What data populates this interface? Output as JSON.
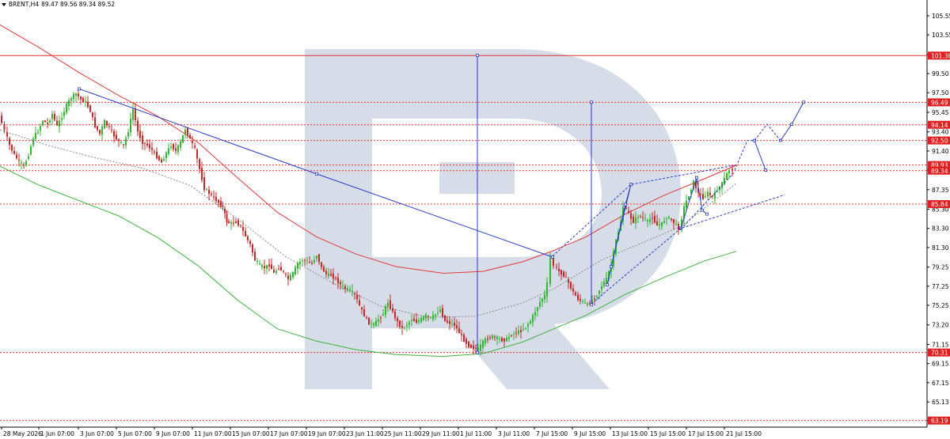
{
  "header": {
    "symbol": "BRENT,H4",
    "ohlc": "89.47 89.56 89.34 89.52"
  },
  "colors": {
    "bull": "#2eb82e",
    "bear": "#c62828",
    "level": "#e03030",
    "projection": "#2a3cc8",
    "ma_red": "#e03a3a",
    "ma_green": "#3cb43c",
    "ma_dotted": "#888888",
    "watermark": "#d6dde9",
    "axis_tag": "#e02020"
  },
  "chart_data": {
    "type": "candlestick",
    "symbol": "BRENT",
    "timeframe": "H4",
    "ylim": [
      62.5,
      107.2
    ],
    "y_ticks": [
      63.19,
      65.13,
      67.15,
      69.15,
      71.15,
      73.2,
      75.25,
      77.25,
      79.25,
      81.3,
      83.3,
      85.3,
      87.35,
      89.4,
      91.4,
      93.4,
      95.45,
      97.5,
      99.5,
      101.5,
      103.55,
      105.55
    ],
    "x_labels": [
      "28 May 2026",
      "1 Jun 07:00",
      "3 Jun 07:00",
      "5 Jun 07:00",
      "9 Jun 07:00",
      "11 Jun 07:00",
      "15 Jun 07:00",
      "17 Jun 07:00",
      "19 Jun 07:00",
      "23 Jun 11:00",
      "25 Jun 11:00",
      "29 Jun 11:00",
      "1 Jul 11:00",
      "3 Jul 11:00",
      "7 Jul 15:00",
      "9 Jul 15:00",
      "13 Jul 15:00",
      "15 Jul 15:00",
      "17 Jul 15:00",
      "21 Jul 15:00"
    ],
    "levels": [
      {
        "price": 101.38,
        "style": "solid",
        "label": "101.38"
      },
      {
        "price": 96.49,
        "style": "dotted",
        "label": "96.49"
      },
      {
        "price": 94.14,
        "style": "dotted",
        "label": "94.14"
      },
      {
        "price": 92.5,
        "style": "dotted",
        "label": "92.50"
      },
      {
        "price": 89.93,
        "style": "dotted",
        "label": "89.93"
      },
      {
        "price": 89.34,
        "style": "dotted",
        "label": "89.34"
      },
      {
        "price": 85.84,
        "style": "dotted",
        "label": "85.84"
      },
      {
        "price": 70.31,
        "style": "dotted",
        "label": "70.31"
      },
      {
        "price": 63.19,
        "style": "dotted",
        "label": "63.19"
      }
    ],
    "price_path": [
      [
        1,
        95.1
      ],
      [
        8,
        93.5
      ],
      [
        14,
        92.0
      ],
      [
        20,
        91.0
      ],
      [
        26,
        90.3
      ],
      [
        32,
        89.8
      ],
      [
        38,
        91.0
      ],
      [
        44,
        92.8
      ],
      [
        50,
        93.5
      ],
      [
        56,
        94.6
      ],
      [
        62,
        94.2
      ],
      [
        68,
        95.3
      ],
      [
        74,
        94.0
      ],
      [
        80,
        95.0
      ],
      [
        86,
        96.2
      ],
      [
        92,
        97.0
      ],
      [
        98,
        97.4
      ],
      [
        104,
        96.8
      ],
      [
        110,
        96.5
      ],
      [
        116,
        95.6
      ],
      [
        122,
        94.0
      ],
      [
        128,
        93.2
      ],
      [
        134,
        94.5
      ],
      [
        140,
        93.8
      ],
      [
        146,
        93.0
      ],
      [
        152,
        92.4
      ],
      [
        158,
        92.0
      ],
      [
        164,
        93.5
      ],
      [
        170,
        95.8
      ],
      [
        176,
        93.4
      ],
      [
        182,
        92.3
      ],
      [
        188,
        92.0
      ],
      [
        194,
        91.5
      ],
      [
        200,
        90.8
      ],
      [
        206,
        90.2
      ],
      [
        212,
        91.2
      ],
      [
        218,
        92.0
      ],
      [
        224,
        91.4
      ],
      [
        230,
        92.3
      ],
      [
        236,
        93.7
      ],
      [
        242,
        92.6
      ],
      [
        248,
        91.6
      ],
      [
        254,
        89.5
      ],
      [
        260,
        87.5
      ],
      [
        266,
        87.0
      ],
      [
        272,
        86.5
      ],
      [
        278,
        86.0
      ],
      [
        283,
        85.5
      ],
      [
        288,
        84.0
      ],
      [
        294,
        83.8
      ],
      [
        300,
        84.0
      ],
      [
        306,
        83.5
      ],
      [
        312,
        82.5
      ],
      [
        318,
        81.6
      ],
      [
        324,
        80.0
      ],
      [
        330,
        79.4
      ],
      [
        336,
        79.2
      ],
      [
        342,
        79.5
      ],
      [
        348,
        78.6
      ],
      [
        354,
        79.2
      ],
      [
        360,
        78.7
      ],
      [
        366,
        78.0
      ],
      [
        372,
        78.6
      ],
      [
        378,
        79.6
      ],
      [
        384,
        80.0
      ],
      [
        390,
        79.8
      ],
      [
        396,
        79.6
      ],
      [
        402,
        80.5
      ],
      [
        408,
        79.2
      ],
      [
        414,
        78.5
      ],
      [
        420,
        78.4
      ],
      [
        426,
        78.0
      ],
      [
        432,
        77.4
      ],
      [
        438,
        77.0
      ],
      [
        444,
        76.8
      ],
      [
        450,
        76.4
      ],
      [
        456,
        75.2
      ],
      [
        462,
        74.2
      ],
      [
        468,
        73.4
      ],
      [
        474,
        73.2
      ],
      [
        480,
        73.8
      ],
      [
        486,
        74.4
      ],
      [
        492,
        75.6
      ],
      [
        498,
        74.5
      ],
      [
        504,
        73.5
      ],
      [
        510,
        72.8
      ],
      [
        516,
        73.2
      ],
      [
        522,
        73.8
      ],
      [
        528,
        73.5
      ],
      [
        534,
        73.8
      ],
      [
        540,
        74.2
      ],
      [
        546,
        73.9
      ],
      [
        552,
        74.3
      ],
      [
        558,
        74.8
      ],
      [
        564,
        73.6
      ],
      [
        570,
        73.4
      ],
      [
        576,
        73.2
      ],
      [
        582,
        72.4
      ],
      [
        588,
        71.6
      ],
      [
        594,
        71.0
      ],
      [
        600,
        70.8
      ],
      [
        606,
        70.6
      ],
      [
        612,
        71.4
      ],
      [
        618,
        71.8
      ],
      [
        624,
        72.0
      ],
      [
        630,
        71.8
      ],
      [
        636,
        71.6
      ],
      [
        642,
        71.7
      ],
      [
        648,
        72.2
      ],
      [
        654,
        72.4
      ],
      [
        660,
        72.6
      ],
      [
        666,
        73.0
      ],
      [
        672,
        73.6
      ],
      [
        678,
        74.6
      ],
      [
        684,
        75.6
      ],
      [
        690,
        76.3
      ],
      [
        694,
        77.5
      ],
      [
        698,
        80.2
      ],
      [
        702,
        79.4
      ],
      [
        708,
        78.8
      ],
      [
        714,
        78.4
      ],
      [
        720,
        77.6
      ],
      [
        726,
        76.6
      ],
      [
        732,
        75.9
      ],
      [
        738,
        75.6
      ],
      [
        744,
        75.3
      ],
      [
        750,
        75.8
      ],
      [
        756,
        76.4
      ],
      [
        762,
        77.3
      ],
      [
        768,
        78.0
      ],
      [
        774,
        79.5
      ],
      [
        780,
        82.0
      ],
      [
        786,
        84.0
      ],
      [
        790,
        85.6
      ],
      [
        796,
        84.8
      ],
      [
        802,
        84.0
      ],
      [
        808,
        84.6
      ],
      [
        814,
        84.4
      ],
      [
        820,
        84.0
      ],
      [
        826,
        84.5
      ],
      [
        832,
        83.6
      ],
      [
        838,
        83.8
      ],
      [
        844,
        84.5
      ],
      [
        850,
        84.2
      ],
      [
        856,
        83.6
      ],
      [
        860,
        83.3
      ],
      [
        866,
        85.5
      ],
      [
        872,
        86.8
      ],
      [
        878,
        88.2
      ],
      [
        884,
        87.0
      ],
      [
        890,
        86.5
      ],
      [
        896,
        87.0
      ],
      [
        902,
        86.6
      ],
      [
        908,
        87.3
      ],
      [
        914,
        88.0
      ],
      [
        920,
        89.0
      ],
      [
        924,
        89.4
      ],
      [
        928,
        89.5
      ]
    ],
    "indicators": {
      "ma_red": [
        [
          0,
          104.6
        ],
        [
          50,
          102.2
        ],
        [
          100,
          99.6
        ],
        [
          150,
          97.2
        ],
        [
          200,
          95.0
        ],
        [
          250,
          92.3
        ],
        [
          300,
          88.6
        ],
        [
          350,
          85.0
        ],
        [
          400,
          82.4
        ],
        [
          450,
          80.6
        ],
        [
          500,
          79.3
        ],
        [
          560,
          78.6
        ],
        [
          610,
          78.8
        ],
        [
          660,
          79.8
        ],
        [
          700,
          81.0
        ],
        [
          740,
          82.4
        ],
        [
          790,
          84.8
        ],
        [
          840,
          86.8
        ],
        [
          890,
          88.5
        ],
        [
          930,
          89.9
        ]
      ],
      "ma_green": [
        [
          0,
          89.8
        ],
        [
          50,
          87.8
        ],
        [
          100,
          86.2
        ],
        [
          150,
          84.6
        ],
        [
          200,
          82.3
        ],
        [
          250,
          79.4
        ],
        [
          300,
          75.8
        ],
        [
          350,
          72.8
        ],
        [
          400,
          71.5
        ],
        [
          450,
          70.6
        ],
        [
          500,
          70.1
        ],
        [
          560,
          69.9
        ],
        [
          610,
          70.2
        ],
        [
          660,
          71.4
        ],
        [
          700,
          72.8
        ],
        [
          740,
          74.2
        ],
        [
          790,
          76.4
        ],
        [
          840,
          78.2
        ],
        [
          890,
          79.9
        ],
        [
          930,
          80.9
        ]
      ],
      "ma_dotted": [
        [
          0,
          93.6
        ],
        [
          60,
          92.0
        ],
        [
          120,
          90.7
        ],
        [
          180,
          89.6
        ],
        [
          240,
          87.8
        ],
        [
          300,
          84.3
        ],
        [
          360,
          80.4
        ],
        [
          420,
          77.6
        ],
        [
          480,
          75.2
        ],
        [
          540,
          74.0
        ],
        [
          600,
          74.1
        ],
        [
          660,
          75.5
        ],
        [
          700,
          77.0
        ],
        [
          760,
          80.0
        ],
        [
          800,
          81.4
        ],
        [
          860,
          83.5
        ],
        [
          930,
          88.0
        ]
      ]
    },
    "projection_solid": [
      [
        [
          100,
          97.9
        ],
        [
          400,
          89.0
        ],
        [
          698,
          80.3
        ]
      ],
      [
        [
          603,
          70.3
        ],
        [
          603,
          101.4
        ]
      ],
      [
        [
          747,
          75.3
        ],
        [
          747,
          96.5
        ]
      ],
      [
        [
          767,
          77.4
        ],
        [
          790,
          85.8
        ],
        [
          797,
          87.9
        ],
        [
          772,
          79.3
        ]
      ],
      [
        [
          860,
          83.3
        ],
        [
          880,
          88.6
        ],
        [
          887,
          85.2
        ],
        [
          893,
          84.8
        ]
      ],
      [
        [
          953,
          92.5
        ],
        [
          967,
          89.4
        ]
      ],
      [
        [
          986,
          92.5
        ],
        [
          1000,
          94.2
        ],
        [
          1015,
          96.5
        ]
      ]
    ],
    "projection_dotted": [
      [
        [
          698,
          80.4
        ],
        [
          797,
          87.9
        ],
        [
          928,
          89.9
        ]
      ],
      [
        [
          747,
          75.4
        ],
        [
          860,
          83.3
        ],
        [
          991,
          86.8
        ]
      ],
      [
        [
          860,
          83.2
        ],
        [
          928,
          89.2
        ]
      ],
      [
        [
          928,
          89.4
        ],
        [
          944,
          92.5
        ],
        [
          953,
          92.5
        ],
        [
          969,
          94.2
        ],
        [
          986,
          92.5
        ]
      ]
    ]
  }
}
